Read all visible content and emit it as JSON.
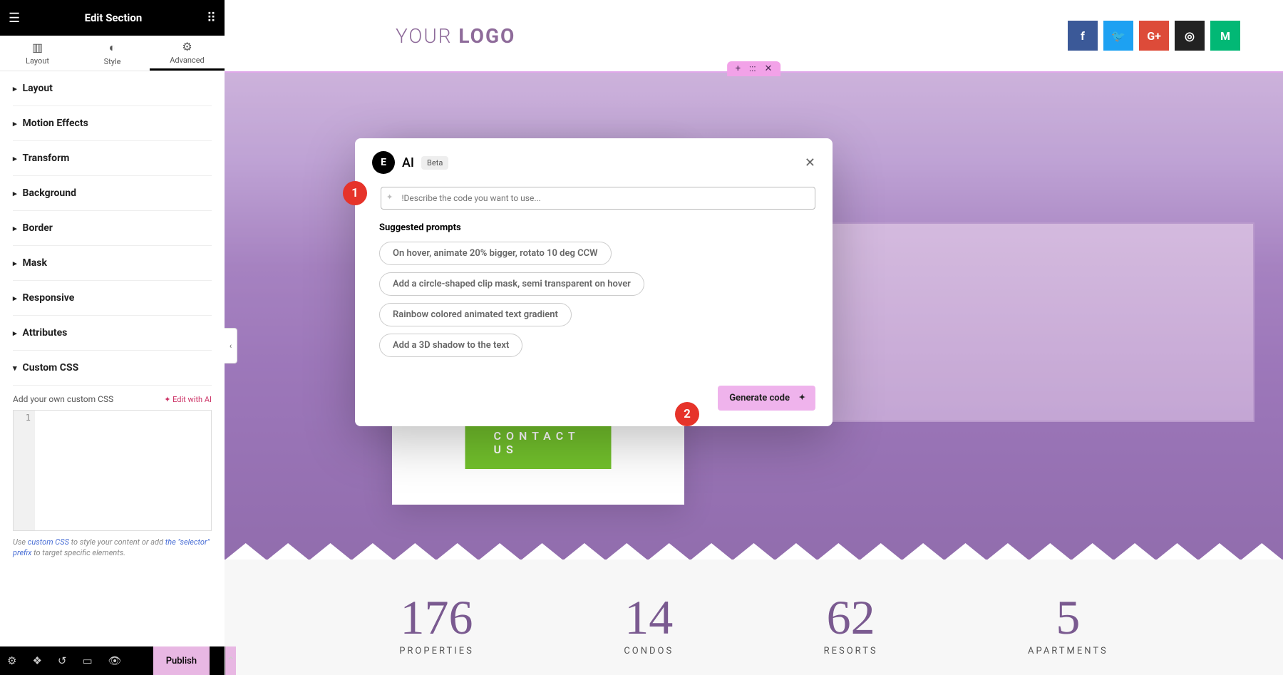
{
  "sidebar": {
    "title": "Edit Section",
    "tabs": {
      "layout": "Layout",
      "style": "Style",
      "advanced": "Advanced"
    },
    "items": [
      "Layout",
      "Motion Effects",
      "Transform",
      "Background",
      "Border",
      "Mask",
      "Responsive",
      "Attributes"
    ],
    "custom_css": "Custom CSS",
    "add_own": "Add your own custom CSS",
    "edit_ai": "✦ Edit with AI",
    "gutter": "1",
    "hint_pre": "Use ",
    "hint_link1": "custom CSS",
    "hint_mid": " to style your content or add ",
    "hint_link2": "the \"selector\" prefix",
    "hint_post": " to target specific elements.",
    "publish": "Publish"
  },
  "preview": {
    "logo_a": "YOUR ",
    "logo_b": "LOGO",
    "socials": {
      "fb": "f",
      "tw": "🐦",
      "gp": "G+",
      "ig": "◎",
      "md": "M"
    },
    "handle": {
      "add": "+",
      "drag": ":::",
      "close": "✕"
    },
    "contact": "CONTACT US",
    "stats": [
      {
        "n": "176",
        "l": "PROPERTIES"
      },
      {
        "n": "14",
        "l": "CONDOS"
      },
      {
        "n": "62",
        "l": "RESORTS"
      },
      {
        "n": "5",
        "l": "APARTMENTS"
      }
    ]
  },
  "modal": {
    "title": "AI",
    "beta": "Beta",
    "placeholder": "!Describe the code you want to use...",
    "sugg_title": "Suggested prompts",
    "chips": [
      "On hover, animate 20% bigger, rotato 10 deg CCW",
      "Add a circle-shaped clip mask, semi transparent on hover",
      "Rainbow colored animated text gradient",
      "Add a 3D shadow to the text"
    ],
    "generate": "Generate code"
  },
  "badges": {
    "one": "1",
    "two": "2"
  }
}
